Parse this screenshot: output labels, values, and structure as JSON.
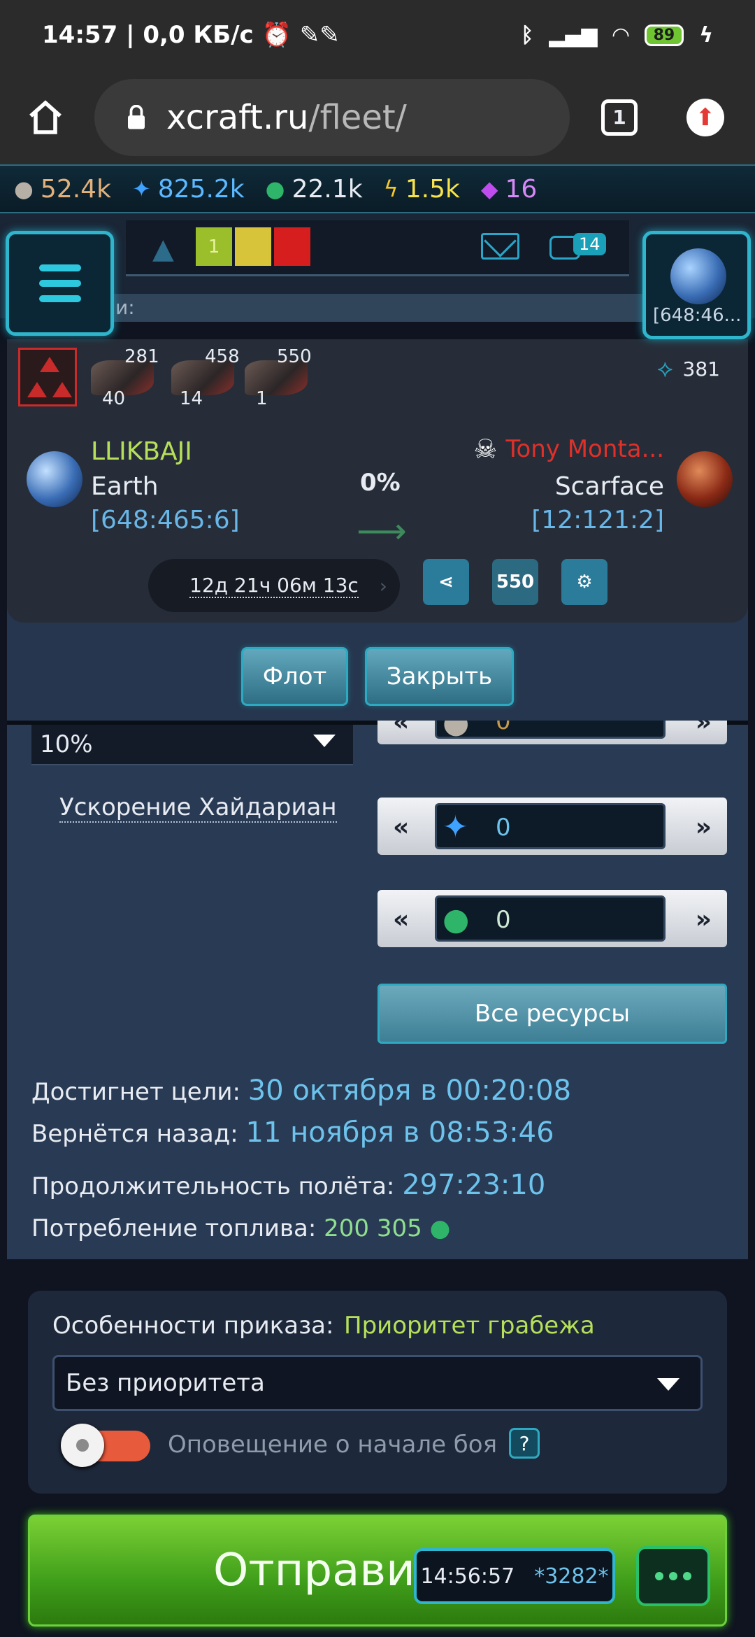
{
  "status_bar": {
    "time": "14:57",
    "net_speed": "0,0 КБ/с",
    "battery": "89"
  },
  "browser": {
    "url_host": "xcraft.ru",
    "url_path": "/fleet/",
    "tab_count": "1"
  },
  "resources": {
    "metal": "52.4k",
    "crystal": "825.2k",
    "deuterium": "22.1k",
    "energy": "1.5k",
    "gems": "16",
    "colors": {
      "metal": "#e3b17a",
      "crystal": "#5cb8ff",
      "deuterium": "#ffffff",
      "energy": "#f7e34a",
      "gems": "#d489f5"
    }
  },
  "header": {
    "level_badge": "1",
    "level_colors": [
      "#9bbf2a",
      "#d7c43a",
      "#d61e1e"
    ],
    "chat_count": "14",
    "subline_text": "и:",
    "planet_coord": "[648:46..."
  },
  "fleet": {
    "ships": [
      {
        "top": "281",
        "bottom": "40"
      },
      {
        "top": "458",
        "bottom": "14"
      },
      {
        "top": "550",
        "bottom": "1"
      }
    ],
    "score": "381",
    "own": {
      "player": "LLIKBAJI",
      "planet": "Earth",
      "coords": "[648:465:6]"
    },
    "progress": "0%",
    "target": {
      "player": "Tony Monta...",
      "planet": "Scarface",
      "coords": "[12:121:2]"
    },
    "timer": "12д 21ч 06м 13с",
    "badge_550": "550"
  },
  "actions": {
    "fleet_button": "Флот",
    "close_button": "Закрыть"
  },
  "form": {
    "speed_value": "10%",
    "boost_label": "Ускорение Хайдариан",
    "res_metal": "0",
    "res_crystal": "0",
    "res_deut": "0",
    "all_resources": "Все ресурсы",
    "arrive_label": "Достигнет цели:",
    "arrive_value": "30 октября в 00:20:08",
    "return_label": "Вернётся назад:",
    "return_value": "11 ноября в 08:53:46",
    "duration_label": "Продолжительность полёта:",
    "duration_value": "297:23:10",
    "fuel_label": "Потребление топлива:",
    "fuel_value": "200 305"
  },
  "orders": {
    "label": "Особенности приказа:",
    "priority_label": "Приоритет грабежа",
    "priority_value": "Без приоритета",
    "notify_label": "Оповещение о начале боя",
    "help": "?"
  },
  "send": {
    "label": "Отправит",
    "clock": "14:56:57",
    "session": "*3282*"
  }
}
